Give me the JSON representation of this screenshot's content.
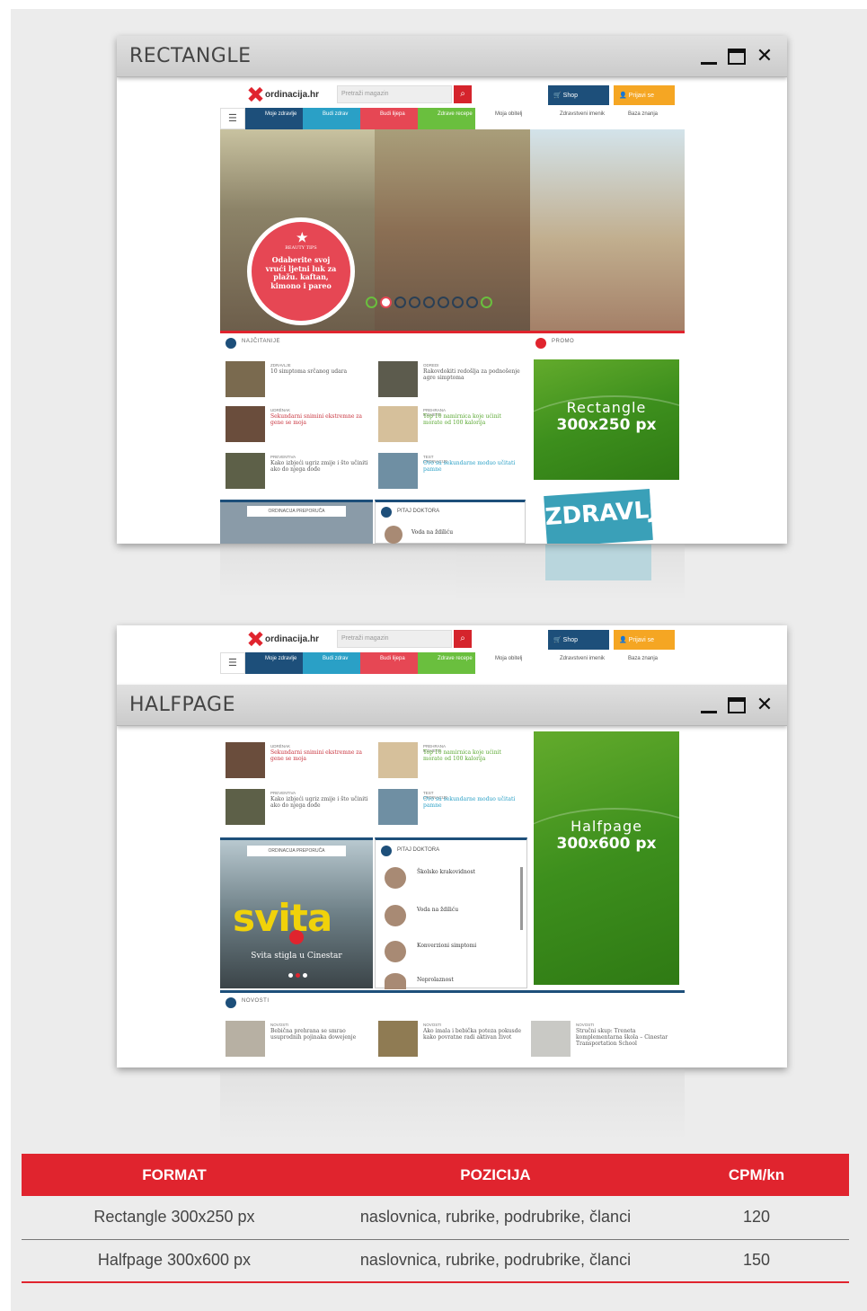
{
  "windows": [
    {
      "title": "RECTANGLE",
      "ad_line1": "Rectangle",
      "ad_line2": "300x250 px"
    },
    {
      "title": "HALFPAGE",
      "ad_line1": "Halfpage",
      "ad_line2": "300x600 px"
    }
  ],
  "site": {
    "logo": "ordinacija.hr",
    "search_placeholder": "Pretraži magazin",
    "shop": "Shop",
    "login": "Prijavi se",
    "nav": [
      "Moje zdravlje",
      "Budi zdrav",
      "Budi lijepa",
      "Zdrave recepe",
      "Moja obitelj",
      "Zdravstveni imenik",
      "Baza znanja"
    ],
    "slider_bubble_cat": "BEAUTY TIPS",
    "slider_bubble_text": "Odaberite svoj vrući ljetni luk za plažu. kaftan, kimono i pareo",
    "section_news": "NAJČITANIJE",
    "section_promo": "PROMO",
    "section_doctors": "PITAJ DOKTORA",
    "section_video": "ORDINACIJA PREPORUČA",
    "section_new": "NOVOSTI",
    "doctor_q1": "Školsko krakovidnost",
    "doctor_q2": "Voda na ždiliću",
    "doctor_q3": "Konverzioni simptomi",
    "doctor_q4": "Neprolaznost",
    "video_caption": "Svita stigla u Cinestar",
    "video_logo": "svita",
    "magazine": "ZDRAVLJE",
    "articles": [
      {
        "cat": "ZDRAVLJE",
        "hl": "10 simptoma srčanog udara"
      },
      {
        "cat": "ODREDI",
        "hl": "Rakovdokiti redošlja za podnošenje agre simptoma"
      },
      {
        "cat": "UDRĒNAK",
        "hl": "Sekundarni snimini ekstremne za gene se moja"
      },
      {
        "cat": "PREHRANA & DIJETE",
        "hl": "Top 10 namirnica koje ućinit morate od 100 kalorija"
      },
      {
        "cat": "PREVENTIVA",
        "hl": "Kako izbjeći ugriz zmije i što učiniti ako do njega dođe"
      },
      {
        "cat": "TEST ORDINACIJE",
        "hl": "Ovo su sekundarne moduo učitati pamne"
      }
    ],
    "articles_new": [
      {
        "cat": "NOVOSTI",
        "hl": "Bebična prehrana se smrao usuprodnih pojinaka dowejenje"
      },
      {
        "cat": "NOVOSTI",
        "hl": "Ako imala i bebička poteza pokusde kako povratne radi aktivan život"
      },
      {
        "cat": "NOVOSTI",
        "hl": "Stručni skup: Treneta komplementarna škola – Cinestar Transportation School"
      }
    ]
  },
  "table": {
    "headers": [
      "FORMAT",
      "POZICIJA",
      "CPM/kn"
    ],
    "rows": [
      [
        "Rectangle 300x250 px",
        "naslovnica, rubrike, podrubrike, članci",
        "120"
      ],
      [
        "Halfpage 300x600 px",
        "naslovnica, rubrike, podrubrike, članci",
        "150"
      ]
    ]
  },
  "colors": {
    "accent": "#e0242e",
    "nav_blue": "#1d4f7a",
    "nav_teal": "#2aa0c6",
    "nav_red": "#e64754",
    "nav_green": "#6abf3e",
    "ad_green": "#4b9a22",
    "login_orange": "#f5a623"
  }
}
